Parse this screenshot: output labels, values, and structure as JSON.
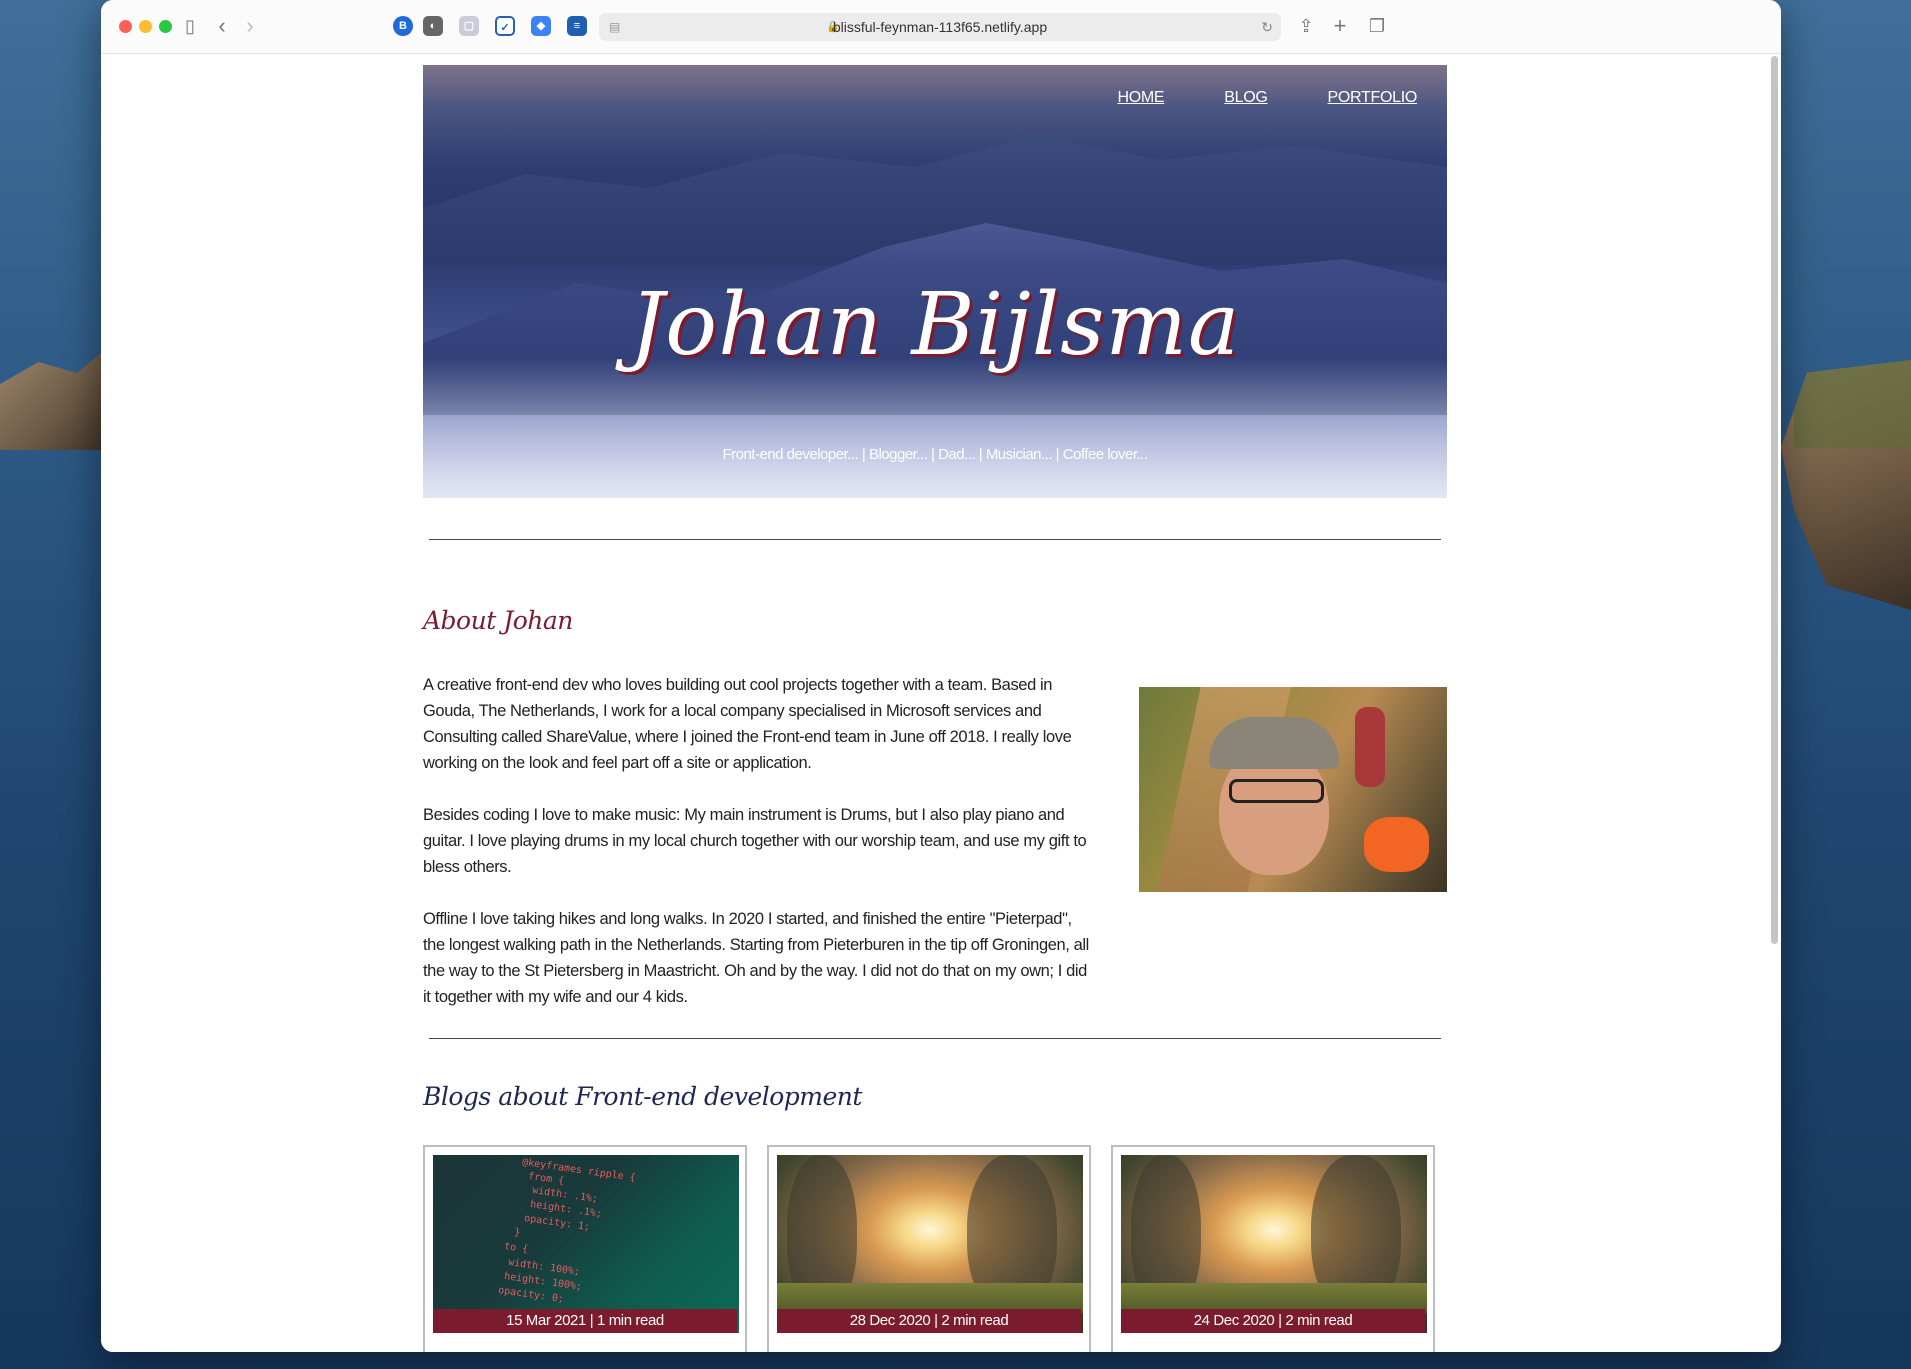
{
  "browser": {
    "url": "blissful-feynman-113f65.netlify.app"
  },
  "nav": {
    "home": "HOME",
    "blog": "BLOG",
    "portfolio": "PORTFOLIO"
  },
  "hero": {
    "title": "Johan Bijlsma",
    "subtitle": "Front-end developer... | Blogger... | Dad... | Musician... | Coffee lover..."
  },
  "about": {
    "title": "About Johan",
    "paragraphs": [
      "A creative front-end dev who loves building out cool projects together with a team. Based in Gouda, The Netherlands, I work for a local company specialised in Microsoft services and Consulting called ShareValue, where I joined the Front-end team in June off 2018. I really love working on the look and feel part off a site or application.",
      "Besides coding I love to make music: My main instrument is Drums, but I also play piano and guitar. I love playing drums in my local church together with our worship team, and use my gift to bless others.",
      "Offline I love taking hikes and long walks. In 2020 I started, and finished the entire \"Pieterpad\", the longest walking path in the Netherlands. Starting from Pieterburen in the tip off Groningen, all the way to the St Pietersberg in Maastricht. Oh and by the way. I did not do that on my own; I did it together with my wife and our 4 kids."
    ]
  },
  "blogs": {
    "title": "Blogs about Front-end development",
    "cards": [
      {
        "meta": "15 Mar 2021 | 1 min read",
        "image": "code"
      },
      {
        "meta": "28 Dec 2020 | 2 min read",
        "image": "sun"
      },
      {
        "meta": "24 Dec 2020 | 2 min read",
        "image": "sun"
      }
    ]
  },
  "code_snippet": [
    "@keyframes ripple {",
    "from {",
    "width: .1%;",
    "height: .1%;",
    "opacity: 1;",
    "}",
    "to {",
    "width: 100%;",
    "height: 100%;",
    "opacity: 0;"
  ],
  "colors": {
    "accent": "#7b1b2e",
    "blog_heading": "#1d2753",
    "divider": "#3c4a5c"
  }
}
